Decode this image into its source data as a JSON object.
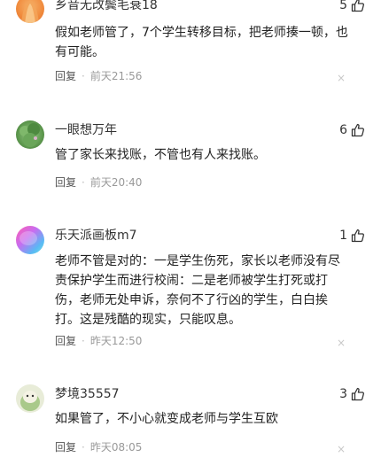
{
  "comments": [
    {
      "username": "乡音无改鬓毛衰18",
      "likes": "5",
      "text": "假如老师管了，7个学生转移目标，把老师揍一顿，也有可能。",
      "reply_label": "回复",
      "time": "前天21:56",
      "avatar_icon": "avatar-orange-icon"
    },
    {
      "username": "一眼想万年",
      "likes": "6",
      "text": "管了家长来找账，不管也有人来找账。",
      "reply_label": "回复",
      "time": "前天20:40",
      "avatar_icon": "avatar-green-plant-icon"
    },
    {
      "username": "乐天派画板m7",
      "likes": "1",
      "text": "老师不管是对的：一是学生伤死，家长以老师没有尽责保护学生而进行校闹：二是老师被学生打死或打伤，老师无处申诉，奈何不了行凶的学生，白白挨打。这是残酷的现实，只能叹息。",
      "reply_label": "回复",
      "time": "昨天12:50",
      "avatar_icon": "avatar-gradient-icon"
    },
    {
      "username": "梦境35557",
      "likes": "3",
      "text": "如果管了，不小心就变成老师与学生互欧",
      "reply_label": "回复",
      "time": "昨天08:05",
      "avatar_icon": "avatar-cartoon-icon"
    }
  ],
  "close_glyph": "×"
}
